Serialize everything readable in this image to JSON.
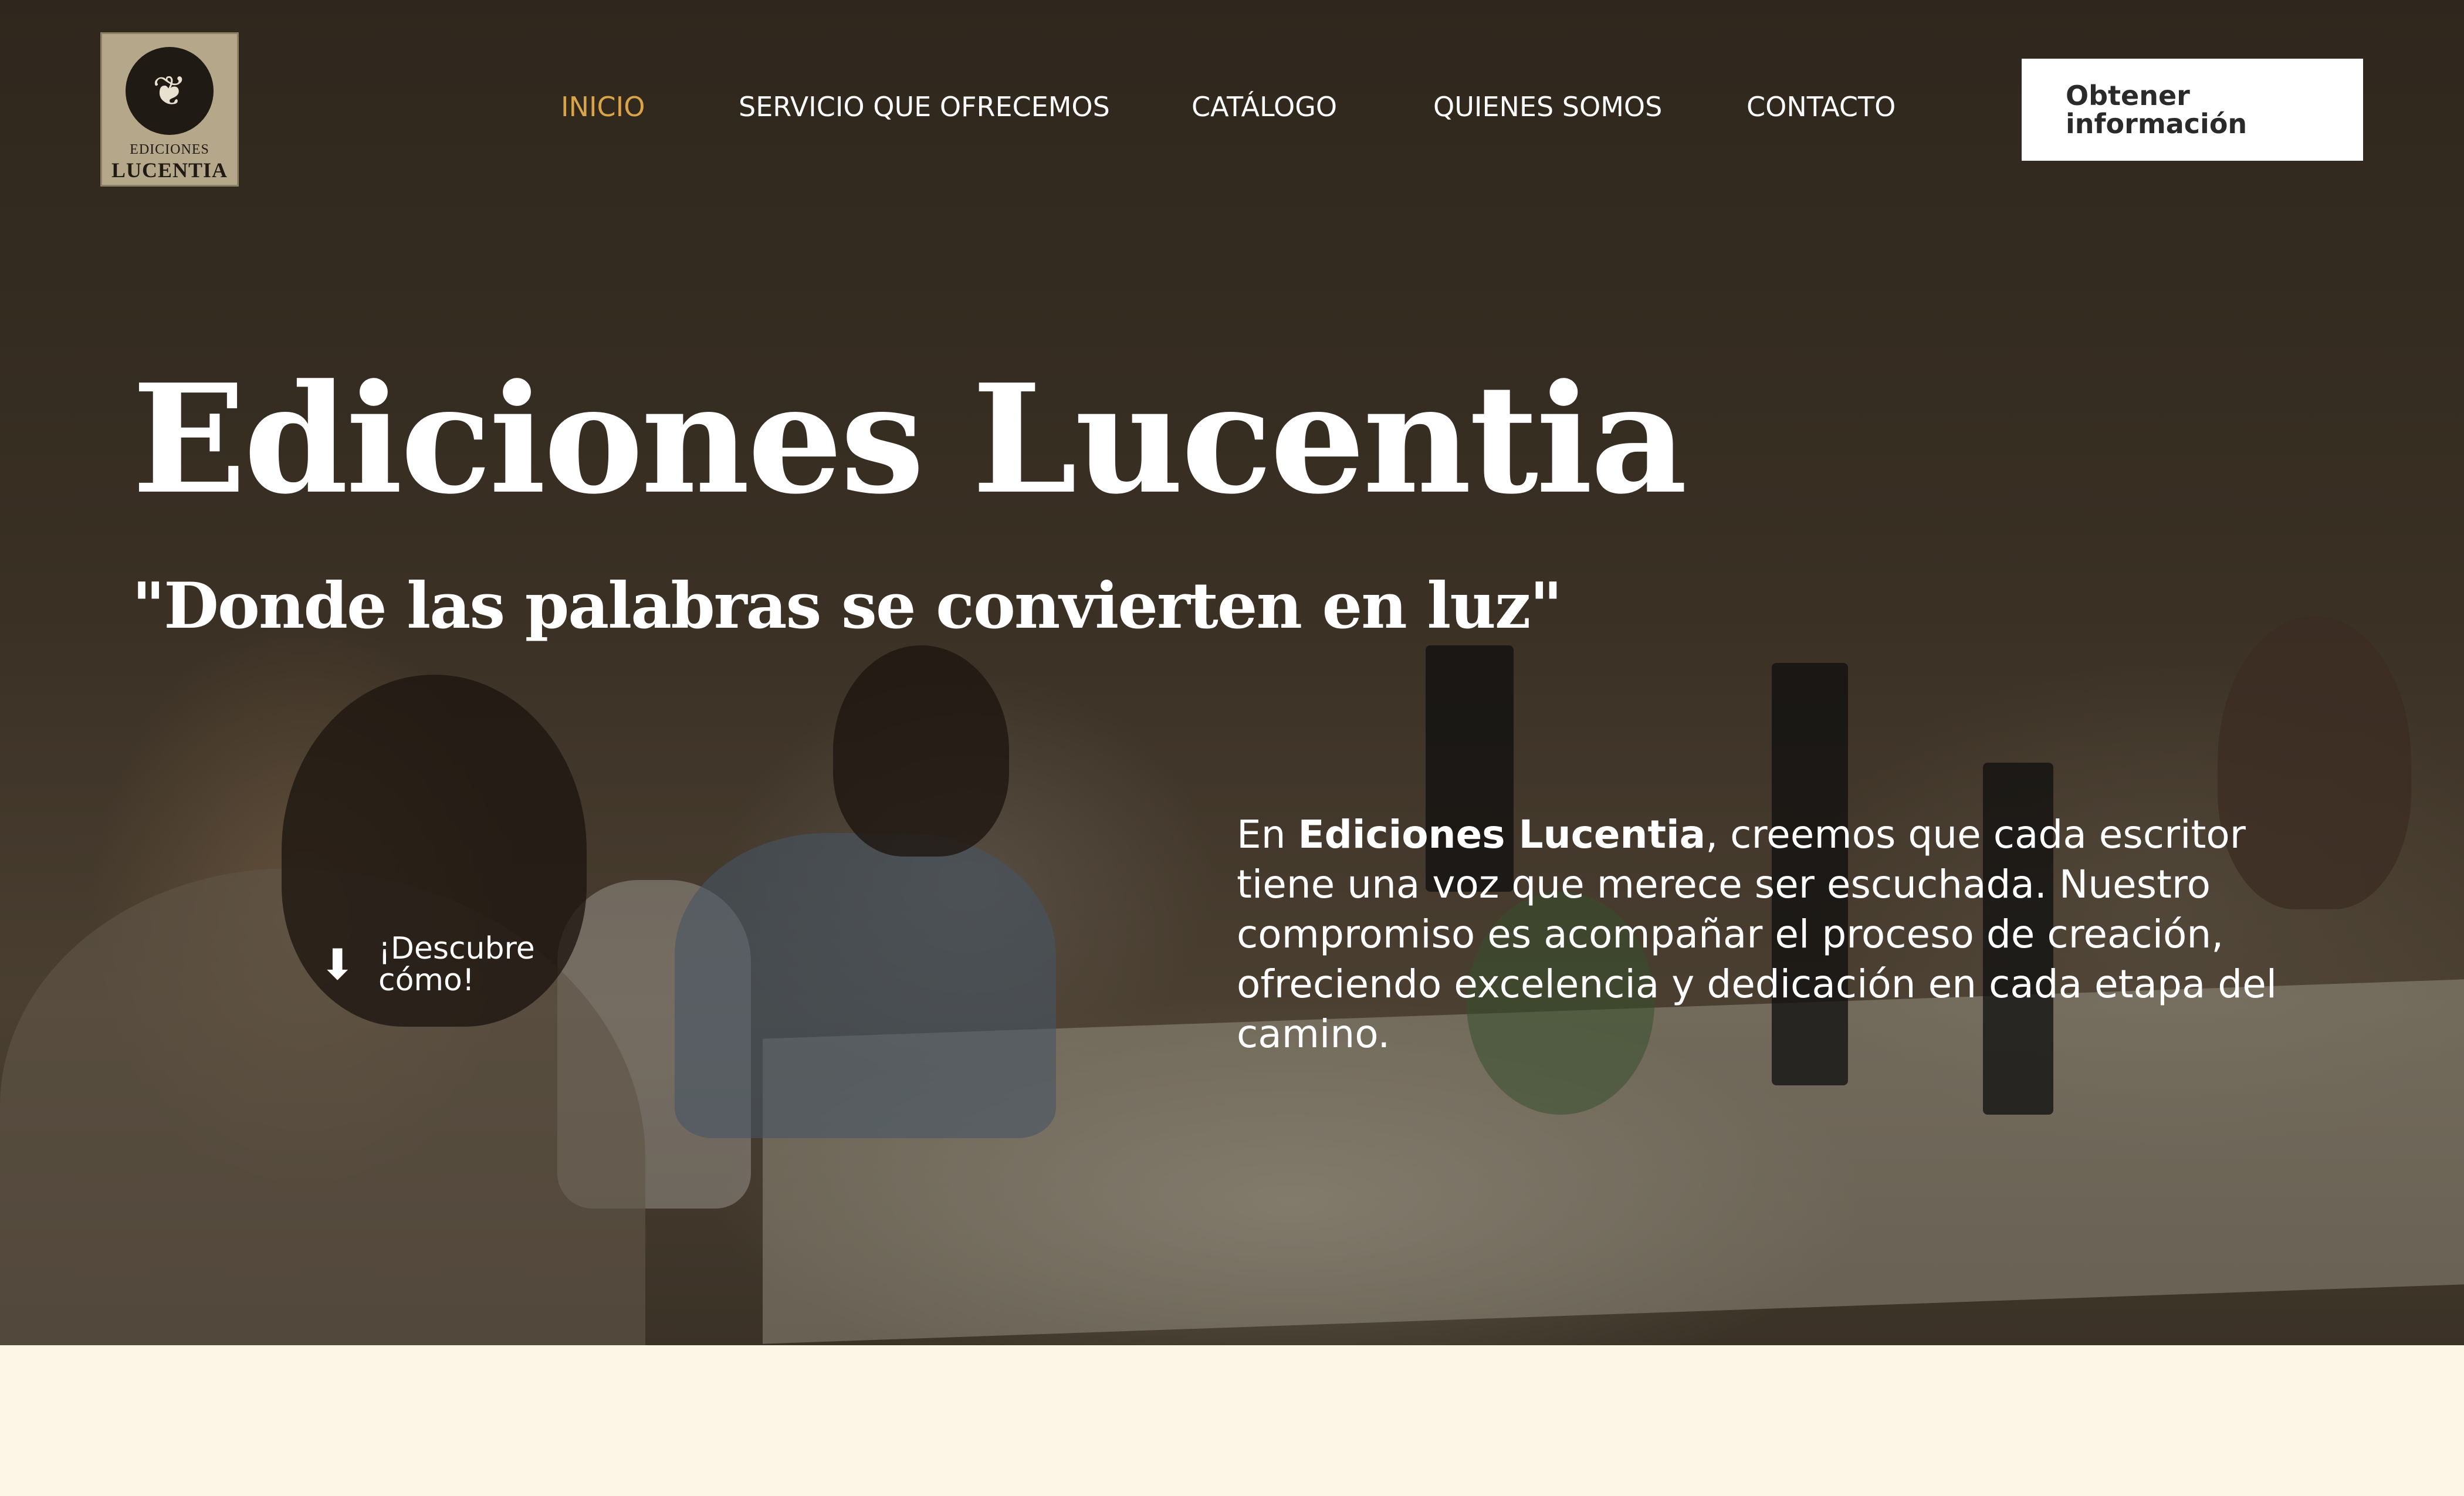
{
  "brand": {
    "logo_line1": "EDICIONES",
    "logo_line2": "LUCENTIA",
    "logo_icon": "open-book-lotus-icon"
  },
  "nav": {
    "items": [
      {
        "label": "INICIO",
        "active": true
      },
      {
        "label": "SERVICIO QUE OFRECEMOS",
        "active": false
      },
      {
        "label": "CATÁLOGO",
        "active": false
      },
      {
        "label": "QUIENES SOMOS",
        "active": false
      },
      {
        "label": "CONTACTO",
        "active": false
      }
    ],
    "cta_label": "Obtener información"
  },
  "hero": {
    "title": "Ediciones Lucentia",
    "tagline": "\"Donde las palabras se convierten en luz\"",
    "discover_label": "¡Descubre cómo!",
    "discover_icon": "arrow-down-icon",
    "intro": {
      "prefix": "En ",
      "brand": "Ediciones Lucentia",
      "rest": ", creemos que cada escritor tiene una voz que merece ser escuchada. Nuestro compromiso es acompañar el proceso de creación, ofreciendo excelencia y dedicación en cada etapa del camino."
    }
  },
  "colors": {
    "accent": "#d9a54a",
    "hero_overlay": "#2f271d",
    "page_background": "#fdf5e6",
    "logo_background": "#b5a88a"
  }
}
